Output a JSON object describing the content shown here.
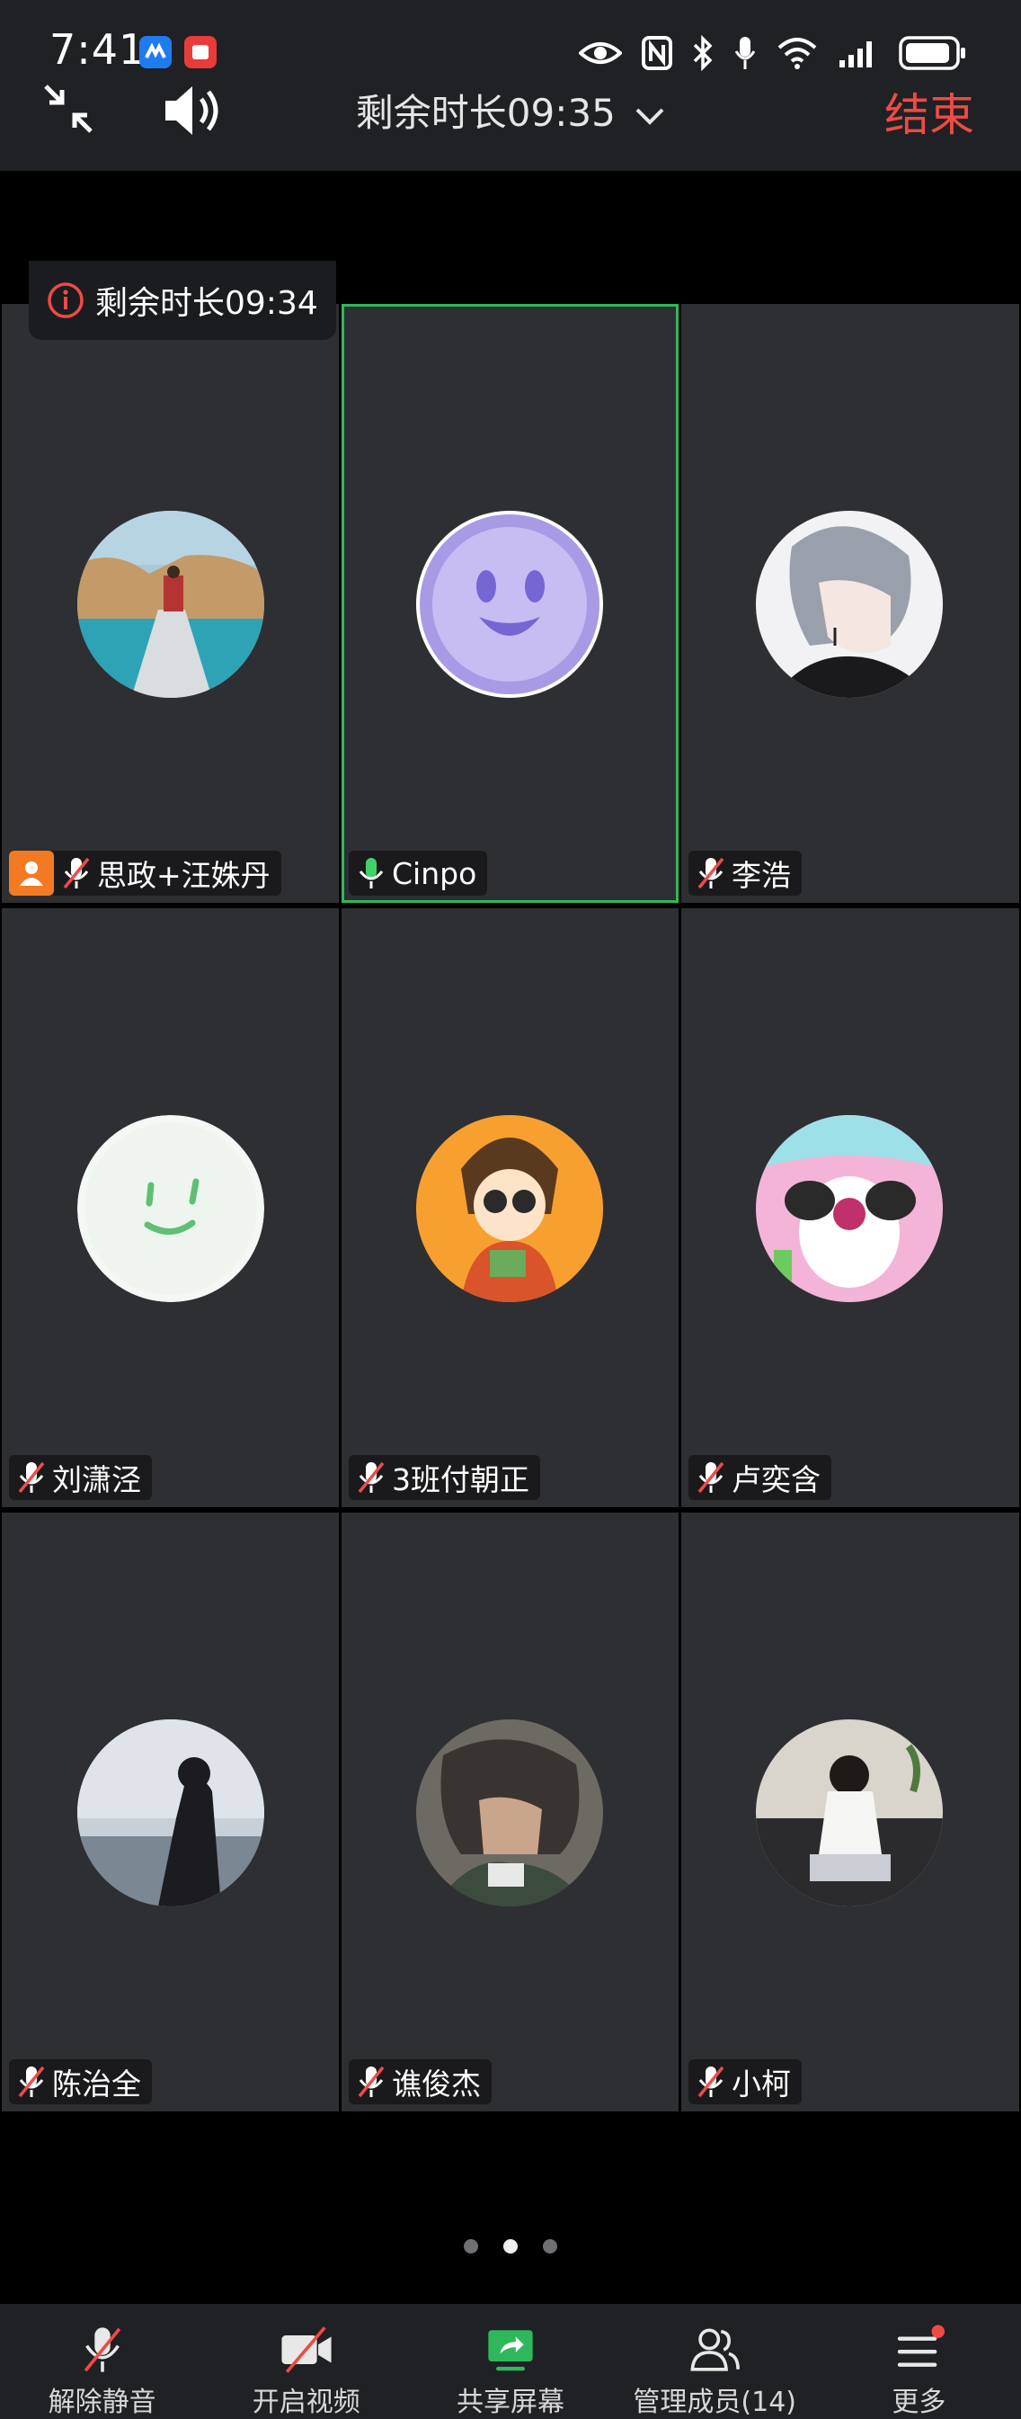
{
  "status_bar": {
    "time": "7:41"
  },
  "meeting_header": {
    "timer": "剩余时长09:35",
    "end_label": "结束"
  },
  "toast": {
    "text": "剩余时长09:34"
  },
  "participants": [
    {
      "name": "思政+汪姝丹",
      "muted": true,
      "host": true
    },
    {
      "name": "Cinpo",
      "muted": false,
      "speaking": true
    },
    {
      "name": "李浩",
      "muted": true
    },
    {
      "name": "刘潇泾",
      "muted": true
    },
    {
      "name": "3班付朝正",
      "muted": true
    },
    {
      "name": "卢奕含",
      "muted": true
    },
    {
      "name": "陈治全",
      "muted": true
    },
    {
      "name": "谯俊杰",
      "muted": true
    },
    {
      "name": "小柯",
      "muted": true
    }
  ],
  "pagination": {
    "pages": 3,
    "current": 2
  },
  "toolbar": {
    "unmute_label": "解除静音",
    "video_label": "开启视频",
    "share_label": "共享屏幕",
    "members_label": "管理成员(14)",
    "more_label": "更多"
  },
  "colors": {
    "accent_green": "#2fb85b",
    "end_red": "#f04a43",
    "host_orange": "#f27a22"
  }
}
